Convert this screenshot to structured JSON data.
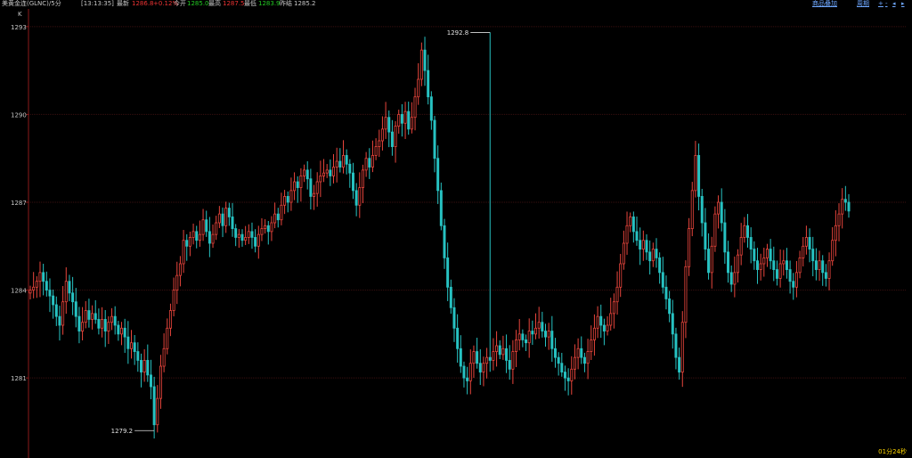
{
  "header": {
    "instrument": "美黄金连(GLNC)/5分",
    "time": "[13:13:35]",
    "latest_label": "最新",
    "latest_value": "1286.8",
    "change_value": "+0.12%",
    "open_label": "今开",
    "open_value": "1285.0",
    "high_label": "最高",
    "high_value": "1287.5",
    "low_label": "最低",
    "low_value": "1283.9",
    "prev_label": "昨结",
    "prev_value": "1285.2",
    "link_add": "商品叠加",
    "link_period": "周期",
    "btn_zoom_in": "+",
    "btn_zoom_out": "-",
    "btn_left": "◂",
    "btn_right": "▸"
  },
  "timer": "01分24秒",
  "colors": {
    "up": "#e8453c",
    "down": "#27c2c2",
    "grid": "#3a0f0f",
    "axis": "#8b1a1a"
  },
  "chart_data": {
    "type": "candlestick",
    "title": "美黄金连(GLNC)/5分",
    "ylim": [
      1278.6,
      1293.3
    ],
    "ticks": [
      1281,
      1284,
      1287,
      1290,
      1293
    ],
    "axis_mark": "K",
    "annotations": [
      {
        "label": "1292.8",
        "value": 1292.8,
        "index": 141
      },
      {
        "label": "1279.2",
        "value": 1279.2,
        "index": 38
      }
    ],
    "close_path": [
      1284.0,
      1284.1,
      1284.3,
      1284.6,
      1284.3,
      1284.0,
      1283.8,
      1283.5,
      1283.1,
      1282.8,
      1283.6,
      1284.3,
      1283.9,
      1283.6,
      1283.1,
      1282.6,
      1282.9,
      1283.3,
      1283.0,
      1283.2,
      1283.0,
      1282.7,
      1283.0,
      1282.6,
      1282.9,
      1283.1,
      1282.8,
      1282.5,
      1282.7,
      1282.4,
      1282.0,
      1282.2,
      1281.9,
      1281.6,
      1281.2,
      1281.6,
      1281.1,
      1280.7,
      1279.4,
      1280.3,
      1281.4,
      1282.0,
      1282.7,
      1283.3,
      1284.0,
      1284.5,
      1284.9,
      1285.7,
      1285.5,
      1285.8,
      1286.0,
      1285.7,
      1285.9,
      1286.4,
      1286.0,
      1285.6,
      1285.9,
      1286.3,
      1286.6,
      1286.2,
      1286.8,
      1286.5,
      1286.1,
      1285.8,
      1285.9,
      1285.7,
      1285.8,
      1286.0,
      1285.8,
      1285.5,
      1285.9,
      1286.1,
      1286.2,
      1286.0,
      1286.3,
      1286.6,
      1286.4,
      1286.9,
      1287.2,
      1287.0,
      1287.4,
      1287.7,
      1287.5,
      1287.9,
      1288.1,
      1287.8,
      1287.2,
      1287.3,
      1287.7,
      1287.9,
      1288.0,
      1288.1,
      1287.9,
      1288.2,
      1288.4,
      1288.2,
      1288.6,
      1288.3,
      1288.0,
      1287.4,
      1286.9,
      1287.5,
      1288.1,
      1288.5,
      1288.2,
      1288.6,
      1288.9,
      1289.1,
      1289.5,
      1289.9,
      1289.4,
      1288.9,
      1289.6,
      1290.0,
      1289.7,
      1290.1,
      1289.5,
      1289.9,
      1290.6,
      1291.2,
      1292.2,
      1291.5,
      1290.6,
      1289.8,
      1288.5,
      1287.4,
      1286.2,
      1285.1,
      1284.1,
      1283.4,
      1282.7,
      1282.0,
      1281.4,
      1281.0,
      1280.9,
      1281.5,
      1281.9,
      1281.5,
      1281.2,
      1281.5,
      1281.7,
      1281.6,
      1281.9,
      1282.1,
      1281.8,
      1282.0,
      1281.6,
      1281.3,
      1281.9,
      1282.3,
      1282.5,
      1282.3,
      1282.2,
      1282.6,
      1282.5,
      1282.7,
      1282.9,
      1282.6,
      1282.4,
      1282.6,
      1282.0,
      1281.7,
      1281.5,
      1281.2,
      1281.0,
      1280.9,
      1281.3,
      1281.7,
      1282.0,
      1281.7,
      1281.5,
      1281.9,
      1282.3,
      1282.7,
      1283.1,
      1282.8,
      1282.6,
      1282.8,
      1283.2,
      1283.6,
      1284.1,
      1284.9,
      1285.6,
      1286.2,
      1286.5,
      1286.0,
      1285.7,
      1285.4,
      1285.7,
      1285.3,
      1285.0,
      1285.4,
      1285.1,
      1284.6,
      1284.1,
      1283.7,
      1283.2,
      1282.5,
      1281.7,
      1281.2,
      1282.9,
      1284.8,
      1286.1,
      1287.4,
      1288.6,
      1287.2,
      1286.3,
      1285.4,
      1284.6,
      1285.5,
      1286.6,
      1287.0,
      1286.3,
      1285.3,
      1284.6,
      1284.2,
      1284.6,
      1285.2,
      1285.8,
      1286.2,
      1285.8,
      1285.4,
      1285.0,
      1284.7,
      1284.9,
      1285.1,
      1285.4,
      1285.0,
      1284.7,
      1284.4,
      1284.9,
      1285.0,
      1284.7,
      1284.3,
      1284.1,
      1284.6,
      1285.1,
      1285.5,
      1285.8,
      1285.4,
      1285.0,
      1284.7,
      1285.0,
      1284.6,
      1284.4,
      1285.0,
      1285.7,
      1286.2,
      1286.6,
      1287.1,
      1287.0,
      1286.7
    ]
  }
}
